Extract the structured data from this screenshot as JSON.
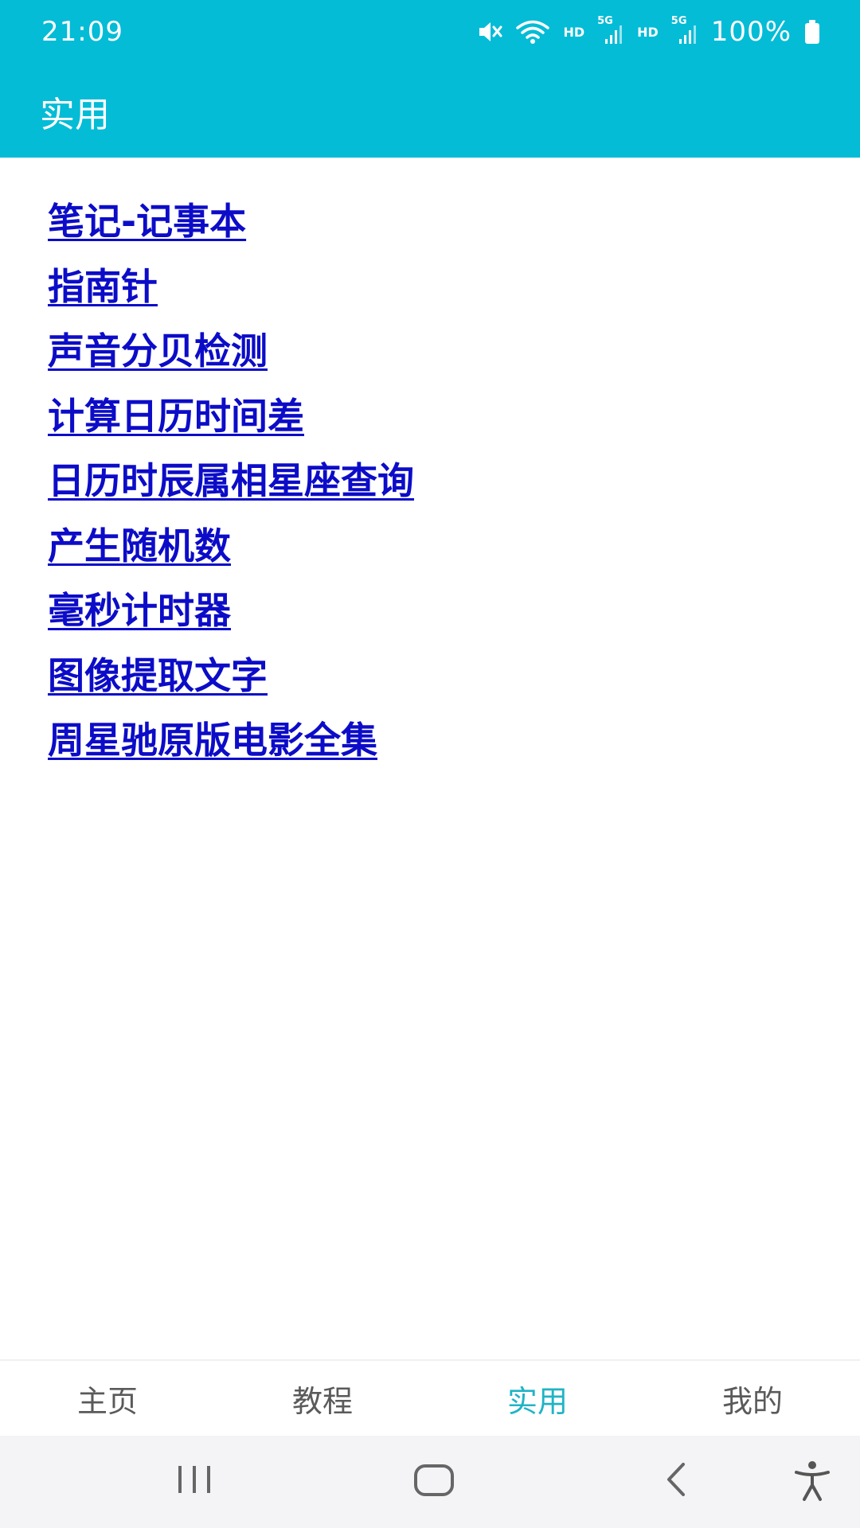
{
  "status_bar": {
    "time": "21:09",
    "hd1": "HD",
    "hd2": "HD",
    "net1": "5G",
    "net2": "5G",
    "battery": "100%",
    "icons": [
      "mute-icon",
      "wifi-icon",
      "signal-icon",
      "signal-icon",
      "battery-icon"
    ]
  },
  "app_bar": {
    "title": "实用"
  },
  "links": [
    "笔记-记事本",
    "指南针",
    "声音分贝检测",
    "计算日历时间差",
    "日历时辰属相星座查询",
    "产生随机数",
    "毫秒计时器",
    "图像提取文字",
    "周星驰原版电影全集"
  ],
  "bottom_nav": [
    {
      "label": "主页",
      "active": false
    },
    {
      "label": "教程",
      "active": false
    },
    {
      "label": "实用",
      "active": true
    },
    {
      "label": "我的",
      "active": false
    }
  ],
  "system_nav": [
    "recent-apps-icon",
    "home-icon",
    "back-icon",
    "accessibility-icon"
  ],
  "colors": {
    "header": "#04bcd6",
    "link": "#0c0cc8",
    "nav_active": "#21b3c6",
    "nav_inactive": "#5a5a5a"
  }
}
